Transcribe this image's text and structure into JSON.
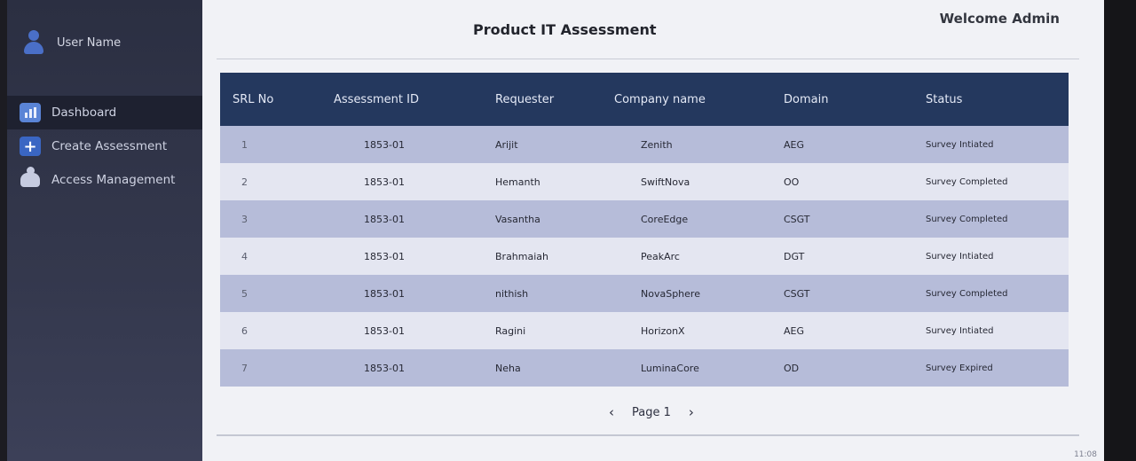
{
  "user": {
    "name": "User Name"
  },
  "nav": [
    {
      "label": "Dashboard",
      "icon": "dashboard-icon"
    },
    {
      "label": "Create Assessment",
      "icon": "plus-icon"
    },
    {
      "label": "Access Management",
      "icon": "users-icon"
    }
  ],
  "header": {
    "title": "Product IT Assessment",
    "welcome": "Welcome Admin"
  },
  "table": {
    "columns": [
      "SRL No",
      "Assessment ID",
      "Requester",
      "Company name",
      "Domain",
      "Status"
    ],
    "rows": [
      {
        "srl": "1",
        "aid": "1853-01",
        "req": "Arijit",
        "comp": "Zenith",
        "dom": "AEG",
        "stat": "Survey Intiated"
      },
      {
        "srl": "2",
        "aid": "1853-01",
        "req": "Hemanth",
        "comp": "SwiftNova",
        "dom": "OO",
        "stat": "Survey Completed"
      },
      {
        "srl": "3",
        "aid": "1853-01",
        "req": "Vasantha",
        "comp": "CoreEdge",
        "dom": "CSGT",
        "stat": "Survey Completed"
      },
      {
        "srl": "4",
        "aid": "1853-01",
        "req": "Brahmaiah",
        "comp": "PeakArc",
        "dom": "DGT",
        "stat": "Survey Intiated"
      },
      {
        "srl": "5",
        "aid": "1853-01",
        "req": "nithish",
        "comp": "NovaSphere",
        "dom": "CSGT",
        "stat": "Survey Completed"
      },
      {
        "srl": "6",
        "aid": "1853-01",
        "req": "Ragini",
        "comp": "HorizonX",
        "dom": "AEG",
        "stat": "Survey Intiated"
      },
      {
        "srl": "7",
        "aid": "1853-01",
        "req": "Neha",
        "comp": "LuminaCore",
        "dom": "OD",
        "stat": "Survey Expired"
      }
    ]
  },
  "pagination": {
    "label": "Page 1",
    "prev": "‹",
    "next": "›"
  },
  "clock": "11:08"
}
